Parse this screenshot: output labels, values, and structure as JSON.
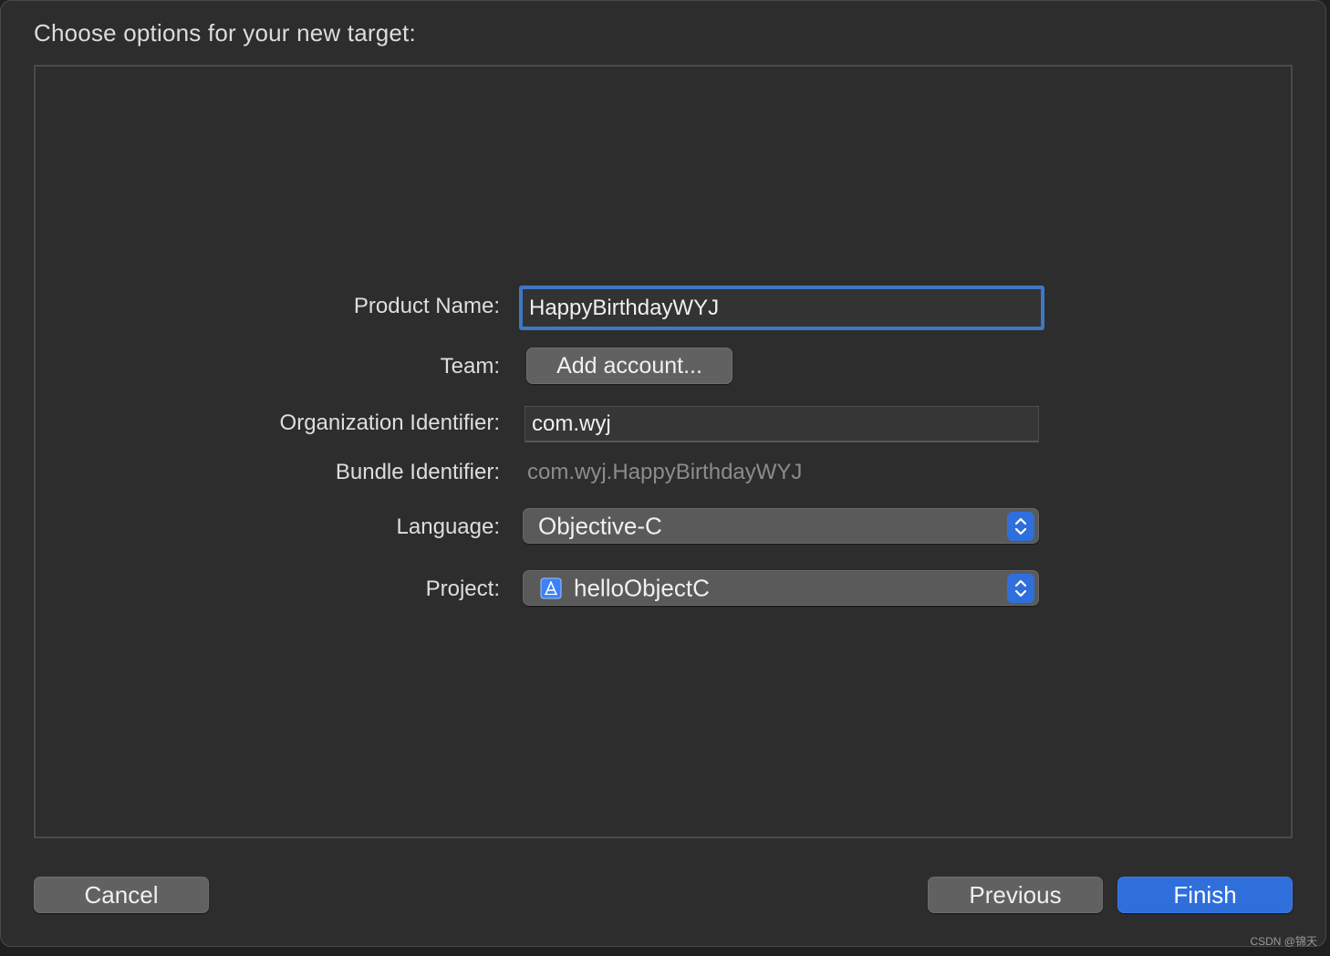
{
  "sheet": {
    "title": "Choose options for your new target:"
  },
  "form": {
    "product_name": {
      "label": "Product Name:",
      "value": "HappyBirthdayWYJ"
    },
    "team": {
      "label": "Team:",
      "button_label": "Add account..."
    },
    "organization_identifier": {
      "label": "Organization Identifier:",
      "value": "com.wyj"
    },
    "bundle_identifier": {
      "label": "Bundle Identifier:",
      "value": "com.wyj.HappyBirthdayWYJ"
    },
    "language": {
      "label": "Language:",
      "selected": "Objective-C"
    },
    "project": {
      "label": "Project:",
      "selected": "helloObjectC",
      "icon": "xcode-project-icon"
    }
  },
  "footer": {
    "cancel_label": "Cancel",
    "previous_label": "Previous",
    "finish_label": "Finish"
  },
  "watermark": "CSDN @锦天",
  "colors": {
    "accent": "#2f6fdc",
    "focus_ring": "#3e77c2",
    "background": "#2d2d2d"
  }
}
